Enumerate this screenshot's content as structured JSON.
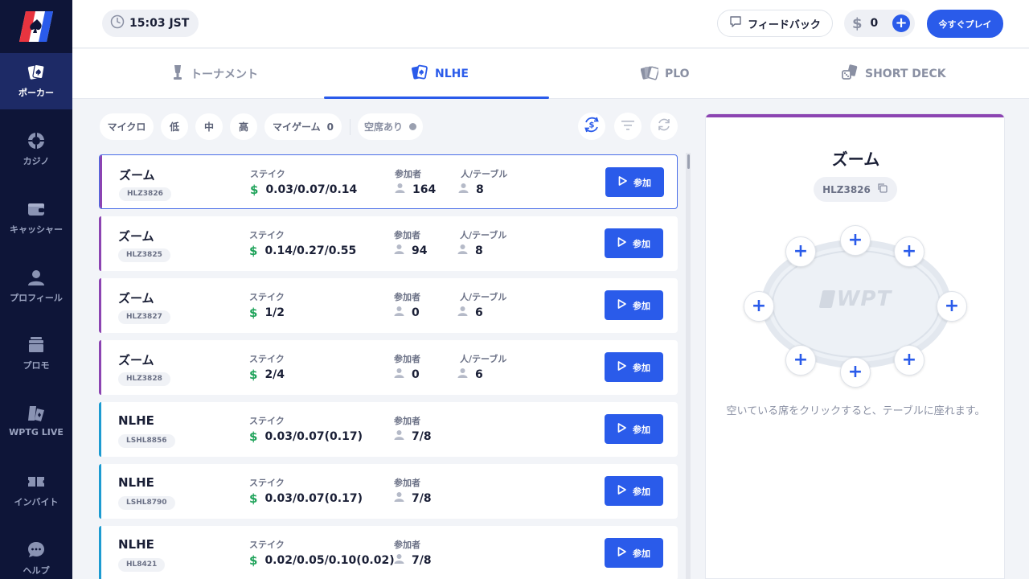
{
  "sidebar": {
    "items": [
      {
        "label": "ポーカー",
        "icon": "poker-cards-icon",
        "active": true
      },
      {
        "label": "カジノ",
        "icon": "casino-chip-icon"
      },
      {
        "label": "キャッシャー",
        "icon": "wallet-icon"
      },
      {
        "label": "プロフィール",
        "icon": "user-icon"
      },
      {
        "label": "プロモ",
        "icon": "promo-gift-icon"
      },
      {
        "label": "WPTG LIVE",
        "icon": "live-icon"
      },
      {
        "label": "インバイト",
        "icon": "ticket-icon"
      },
      {
        "label": "ヘルプ",
        "icon": "chat-help-icon"
      }
    ]
  },
  "header": {
    "time": "15:03 JST",
    "feedback_label": "フィードバック",
    "balance": "0",
    "play_now_label": "今すぐプレイ"
  },
  "tabs": [
    {
      "label": "トーナメント",
      "icon": "trophy-icon"
    },
    {
      "label": "NLHE",
      "icon": "cards-icon",
      "active": true
    },
    {
      "label": "PLO",
      "icon": "four-cards-icon"
    },
    {
      "label": "SHORT DECK",
      "icon": "dice-cards-icon"
    }
  ],
  "filters": {
    "micro": "マイクロ",
    "low": "低",
    "mid": "中",
    "high": "高",
    "my_games": "マイゲーム",
    "my_games_count": "0",
    "seats_available": "空席あり"
  },
  "list": {
    "labels": {
      "stake": "ステイク",
      "players": "参加者",
      "per_table": "人/テーブル",
      "join": "参加"
    },
    "rows": [
      {
        "name": "ズーム",
        "code": "HLZ3826",
        "stake": "0.03/0.07/0.14",
        "players": "164",
        "per_table": "8",
        "color": "#8c44b2",
        "selected": true
      },
      {
        "name": "ズーム",
        "code": "HLZ3825",
        "stake": "0.14/0.27/0.55",
        "players": "94",
        "per_table": "8",
        "color": "#8c44b2"
      },
      {
        "name": "ズーム",
        "code": "HLZ3827",
        "stake": "1/2",
        "players": "0",
        "per_table": "6",
        "color": "#8c44b2"
      },
      {
        "name": "ズーム",
        "code": "HLZ3828",
        "stake": "2/4",
        "players": "0",
        "per_table": "6",
        "color": "#8c44b2"
      },
      {
        "name": "NLHE",
        "code": "LSHL8856",
        "stake": "0.03/0.07(0.17)",
        "players": "7/8",
        "color": "#1d9bd1"
      },
      {
        "name": "NLHE",
        "code": "LSHL8790",
        "stake": "0.03/0.07(0.17)",
        "players": "7/8",
        "color": "#1d9bd1"
      },
      {
        "name": "NLHE",
        "code": "HL8421",
        "stake": "0.02/0.05/0.10(0.02)",
        "players": "7/8",
        "color": "#1d9bd1"
      }
    ]
  },
  "panel": {
    "title": "ズーム",
    "code": "HLZ3826",
    "table_logo": "WPT",
    "hint": "空いている席をクリックすると、テーブルに座れます。",
    "seat_symbol": "+"
  },
  "colors": {
    "accent": "#2a5bea",
    "sidebar_bg": "#0e1538",
    "zoom_bar": "#8c44b2",
    "nlhe_bar": "#1d9bd1",
    "stake_dollar": "#1fa35a"
  }
}
